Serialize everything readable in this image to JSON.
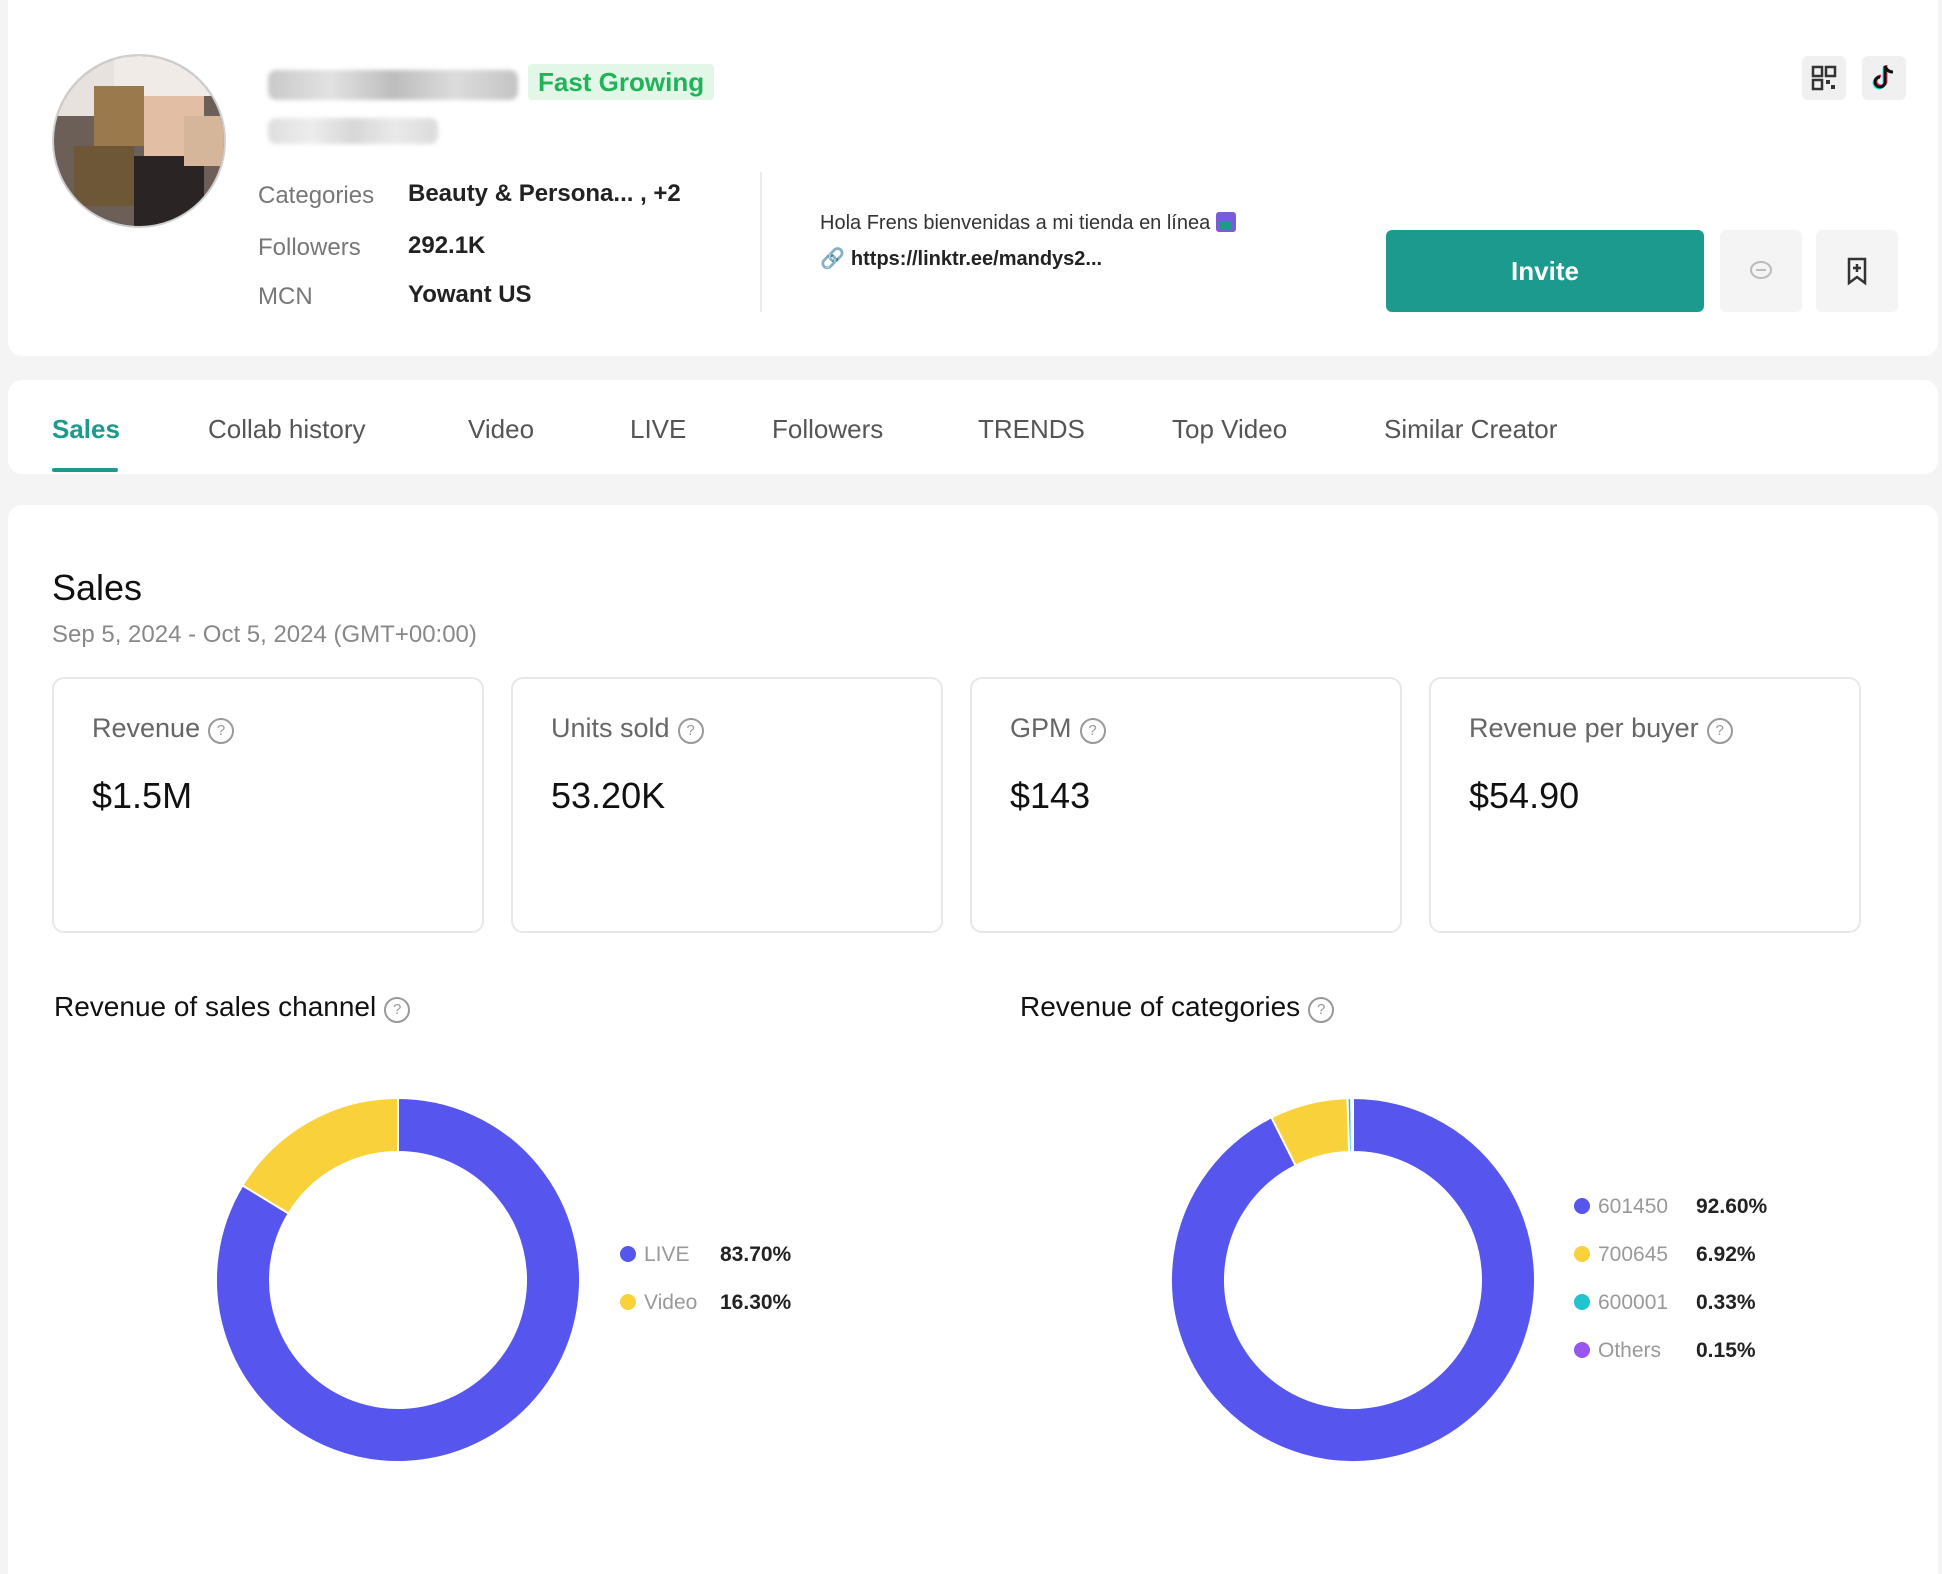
{
  "profile": {
    "badge": "Fast Growing",
    "meta": [
      {
        "label": "Categories",
        "value": "Beauty & Persona... , +2"
      },
      {
        "label": "Followers",
        "value": "292.1K"
      },
      {
        "label": "MCN",
        "value": "Yowant US"
      }
    ],
    "bio": "Hola Frens bienvenidas a mi tienda en línea",
    "bio_link": "https://linktr.ee/mandys2...",
    "invite_label": "Invite"
  },
  "tabs": [
    {
      "label": "Sales",
      "active": true
    },
    {
      "label": "Collab history",
      "active": false
    },
    {
      "label": "Video",
      "active": false
    },
    {
      "label": "LIVE",
      "active": false
    },
    {
      "label": "Followers",
      "active": false
    },
    {
      "label": "TRENDS",
      "active": false
    },
    {
      "label": "Top Video",
      "active": false
    },
    {
      "label": "Similar Creator",
      "active": false
    }
  ],
  "sales": {
    "title": "Sales",
    "date_range": "Sep 5, 2024 - Oct 5, 2024 (GMT+00:00)",
    "metrics": [
      {
        "label": "Revenue",
        "value": "$1.5M"
      },
      {
        "label": "Units sold",
        "value": "53.20K"
      },
      {
        "label": "GPM",
        "value": "$143"
      },
      {
        "label": "Revenue per buyer",
        "value": "$54.90"
      }
    ],
    "channel_title": "Revenue of sales channel",
    "categories_title": "Revenue of categories"
  },
  "colors": {
    "accent": "#1c9a8e",
    "badge_text": "#21b35a",
    "series_blue": "#5656ef",
    "series_yellow": "#f9d13a",
    "series_teal": "#22c4cf",
    "series_purple": "#9a55f0"
  },
  "chart_data": [
    {
      "type": "pie",
      "title": "Revenue of sales channel",
      "categories": [
        "LIVE",
        "Video"
      ],
      "values": [
        83.7,
        16.3
      ],
      "labels": [
        "83.70%",
        "16.30%"
      ],
      "colors": [
        "#5656ef",
        "#f9d13a"
      ],
      "legend": "right"
    },
    {
      "type": "pie",
      "title": "Revenue of categories",
      "categories": [
        "601450",
        "700645",
        "600001",
        "Others"
      ],
      "values": [
        92.6,
        6.92,
        0.33,
        0.15
      ],
      "labels": [
        "92.60%",
        "6.92%",
        "0.33%",
        "0.15%"
      ],
      "colors": [
        "#5656ef",
        "#f9d13a",
        "#22c4cf",
        "#9a55f0"
      ],
      "legend": "right"
    }
  ]
}
